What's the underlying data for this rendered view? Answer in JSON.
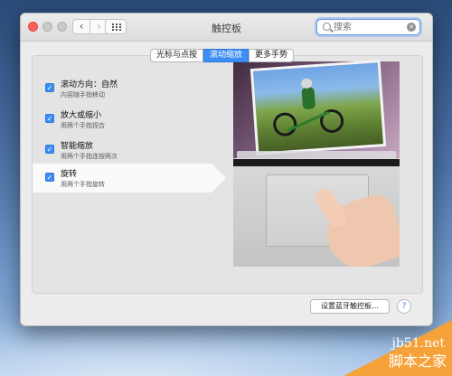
{
  "window": {
    "title": "触控板"
  },
  "toolbar": {
    "back_glyph": "‹",
    "forward_glyph": "›"
  },
  "search": {
    "placeholder": "搜索",
    "clear_glyph": "✕"
  },
  "tabs": [
    {
      "label": "光标与点按",
      "active": false
    },
    {
      "label": "滚动缩放",
      "active": true
    },
    {
      "label": "更多手势",
      "active": false
    }
  ],
  "options": [
    {
      "title": "滚动方向：自然",
      "subtitle": "内容随手指移动",
      "checked": true,
      "selected": false
    },
    {
      "title": "放大或缩小",
      "subtitle": "用两个手指捏合",
      "checked": true,
      "selected": false
    },
    {
      "title": "智能缩放",
      "subtitle": "用两个手指连按两次",
      "checked": true,
      "selected": false
    },
    {
      "title": "旋转",
      "subtitle": "用两个手指旋转",
      "checked": true,
      "selected": true
    }
  ],
  "checkmark": "✓",
  "footer": {
    "bluetooth_button": "设置蓝牙触控板…",
    "help_glyph": "?"
  },
  "watermark": {
    "url": "jb51.net",
    "site": "脚本之家"
  },
  "colors": {
    "accent": "#3c8df6",
    "close": "#fc605b"
  }
}
